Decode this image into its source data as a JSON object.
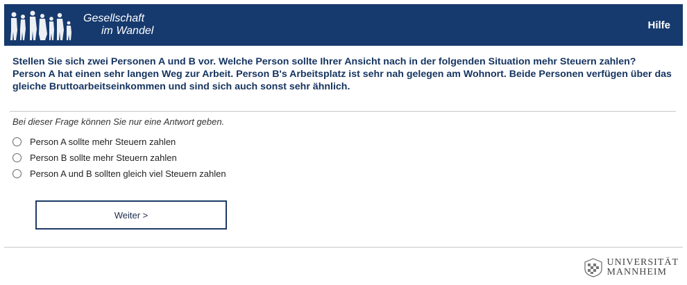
{
  "header": {
    "logo_line1": "Gesellschaft",
    "logo_line2": "im Wandel",
    "help_label": "Hilfe",
    "colors": {
      "header_bg": "#163a6e",
      "header_text": "#ffffff"
    }
  },
  "question": {
    "line1": "Stellen Sie sich zwei Personen A und B vor. Welche Person sollte Ihrer Ansicht nach in der folgenden Situation mehr Steuern zahlen?",
    "line2": "Person A hat einen sehr langen Weg zur Arbeit. Person B's Arbeitsplatz ist sehr nah gelegen am Wohnort. Beide Personen verfügen über das gleiche Bruttoarbeitseinkommen und sind sich auch sonst sehr ähnlich."
  },
  "instruction": "Bei dieser Frage können Sie nur eine Antwort geben.",
  "options": [
    {
      "label": "Person A sollte mehr Steuern zahlen",
      "selected": false
    },
    {
      "label": "Person B sollte mehr Steuern zahlen",
      "selected": false
    },
    {
      "label": "Person A und B sollten gleich viel Steuern zahlen",
      "selected": false
    }
  ],
  "next_button": "Weiter >",
  "footer": {
    "uni_line1": "UNIVERSITÄT",
    "uni_line2": "MANNHEIM"
  }
}
